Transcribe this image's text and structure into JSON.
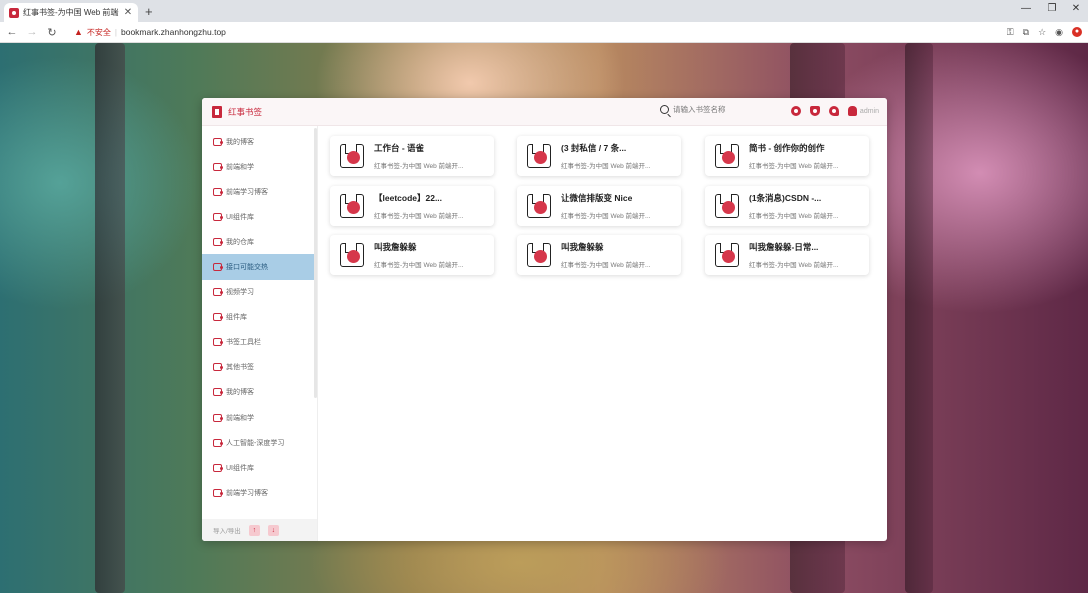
{
  "browser": {
    "tab_title": "红事书签-为中国 Web 前端开发…",
    "new_tab": "+",
    "security_label": "不安全",
    "url": "bookmark.zhanhongzhu.top"
  },
  "app": {
    "title": "红事书签",
    "search_placeholder": "请输入书签名称",
    "user_name": "admin",
    "accent_color": "#c8283c"
  },
  "sidebar": {
    "items": [
      {
        "label": "我的博客",
        "active": false
      },
      {
        "label": "前端和学",
        "active": false
      },
      {
        "label": "前端学习博客",
        "active": false
      },
      {
        "label": "UI组件库",
        "active": false
      },
      {
        "label": "我的仓库",
        "active": false
      },
      {
        "label": "接口可能交热",
        "active": true
      },
      {
        "label": "视频学习",
        "active": false
      },
      {
        "label": "组件库",
        "active": false
      },
      {
        "label": "书签工具栏",
        "active": false
      },
      {
        "label": "其他书签",
        "active": false
      },
      {
        "label": "我的博客",
        "active": false
      },
      {
        "label": "前端和学",
        "active": false
      },
      {
        "label": "人工智能-深度学习",
        "active": false
      },
      {
        "label": "UI组件库",
        "active": false
      },
      {
        "label": "前端学习博客",
        "active": false
      }
    ],
    "footer_text": "导入/导出"
  },
  "cards": [
    {
      "title": "工作台 - 语雀",
      "subtitle": "红事书签-为中国 Web 前端开..."
    },
    {
      "title": "(3 封私信 / 7 条...",
      "subtitle": "红事书签-为中国 Web 前端开..."
    },
    {
      "title": "简书 - 创作你的创作",
      "subtitle": "红事书签-为中国 Web 前端开..."
    },
    {
      "title": "【leetcode】22...",
      "subtitle": "红事书签-为中国 Web 前端开..."
    },
    {
      "title": "让微信排版变 Nice",
      "subtitle": "红事书签-为中国 Web 前端开..."
    },
    {
      "title": "(1条消息)CSDN -...",
      "subtitle": "红事书签-为中国 Web 前端开..."
    },
    {
      "title": "叫我詹躲躲",
      "subtitle": "红事书签-为中国 Web 前端开..."
    },
    {
      "title": "叫我詹躲躲",
      "subtitle": "红事书签-为中国 Web 前端开..."
    },
    {
      "title": "叫我詹躲躲-日常...",
      "subtitle": "红事书签-为中国 Web 前端开..."
    }
  ]
}
